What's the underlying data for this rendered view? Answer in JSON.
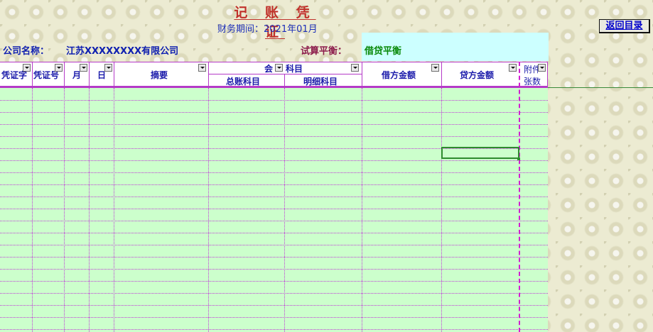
{
  "header": {
    "title": "记 账 凭 证",
    "period": "财务期间：2021年01月",
    "back_button": "返回目录"
  },
  "info": {
    "company_label": "公司名称：",
    "company_name": "江苏XXXXXXXX有限公司",
    "trial_label": "试算平衡：",
    "trial_value": "借贷平衡"
  },
  "table": {
    "columns": {
      "voucher_type": "凭证字",
      "voucher_no": "凭证号",
      "month": "月",
      "day": "日",
      "summary": "摘要",
      "account_part1": "会",
      "account_part2": "科目",
      "general_ledger": "总账科目",
      "detail_account": "明细科目",
      "debit": "借方金额",
      "credit": "贷方金额",
      "attach_1": "附件",
      "attach_2": "张数"
    },
    "rows": []
  },
  "colors": {
    "grid_fill": "#ccffcc",
    "trial_fill": "#ccffff",
    "gridline": "#c03ad8",
    "title": "#c0302a"
  }
}
